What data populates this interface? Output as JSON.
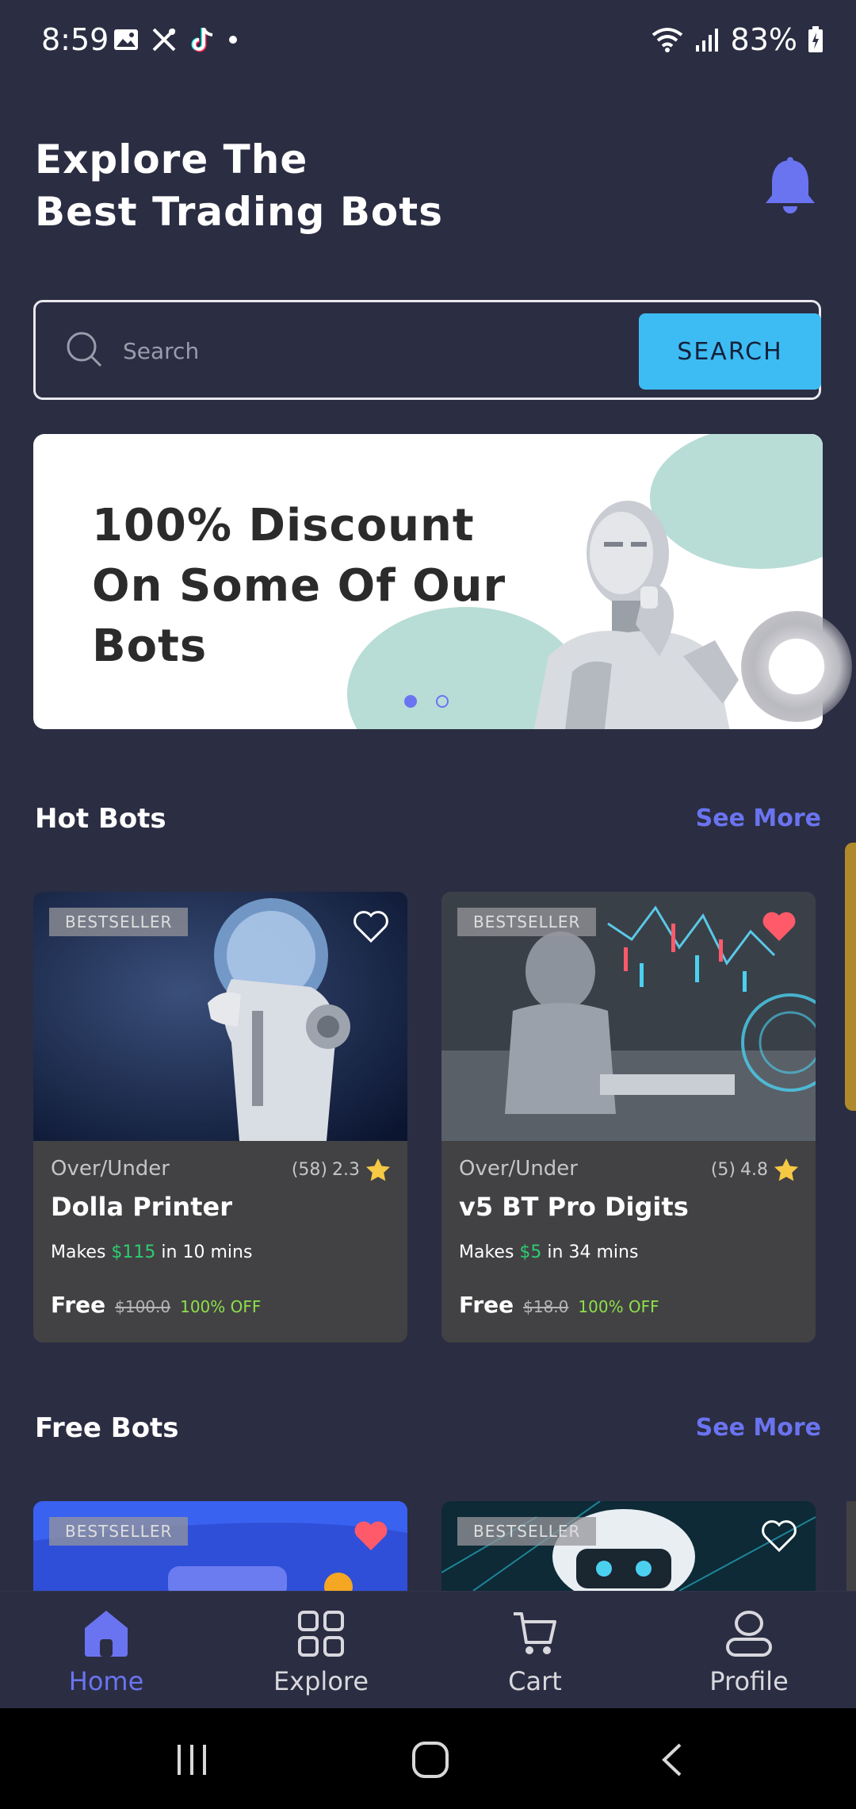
{
  "status": {
    "time": "8:59",
    "battery": "83%",
    "left_icons": [
      "gallery-icon",
      "tools-icon",
      "tiktok-icon",
      "dot-icon"
    ],
    "right_icons": [
      "wifi-icon",
      "signal-icon",
      "battery-icon"
    ]
  },
  "header": {
    "title_line1": "Explore The",
    "title_line2": "Best Trading Bots"
  },
  "search": {
    "placeholder": "Search",
    "button_label": "SEARCH"
  },
  "banner": {
    "line1": "100% Discount",
    "line2": "On Some Of Our",
    "line3": "Bots",
    "pages": 2,
    "active_page": 1
  },
  "hot_bots": {
    "title": "Hot Bots",
    "see_more": "See More",
    "cards": [
      {
        "badge": "BESTSELLER",
        "category": "Over/Under",
        "rating_count": "(58)",
        "rating": "2.3",
        "name": "Dolla Printer",
        "makes_prefix": "Makes",
        "makes_amount": "$115",
        "makes_time": "in 10 mins",
        "price": "Free",
        "old_price": "$100.0",
        "discount": "100% OFF",
        "favorited": false
      },
      {
        "badge": "BESTSELLER",
        "category": "Over/Under",
        "rating_count": "(5)",
        "rating": "4.8",
        "name": "v5 BT Pro Digits",
        "makes_prefix": "Makes",
        "makes_amount": "$5",
        "makes_time": "in 34 mins",
        "price": "Free",
        "old_price": "$18.0",
        "discount": "100% OFF",
        "favorited": true
      }
    ]
  },
  "free_bots": {
    "title": "Free Bots",
    "see_more": "See More",
    "cards": [
      {
        "badge": "BESTSELLER",
        "favorited": true
      },
      {
        "badge": "BESTSELLER",
        "favorited": false
      }
    ]
  },
  "bottom_nav": {
    "items": [
      {
        "label": "Home",
        "icon": "home-icon",
        "active": true
      },
      {
        "label": "Explore",
        "icon": "grid-icon",
        "active": false
      },
      {
        "label": "Cart",
        "icon": "cart-icon",
        "active": false
      },
      {
        "label": "Profile",
        "icon": "profile-icon",
        "active": false
      }
    ]
  },
  "colors": {
    "background": "#2b2d42",
    "accent": "#6a74f0",
    "search_button": "#3dbcf4",
    "card": "#424244",
    "favorite": "#ff5a6a",
    "star": "#f6c945",
    "green": "#2ecc71"
  }
}
